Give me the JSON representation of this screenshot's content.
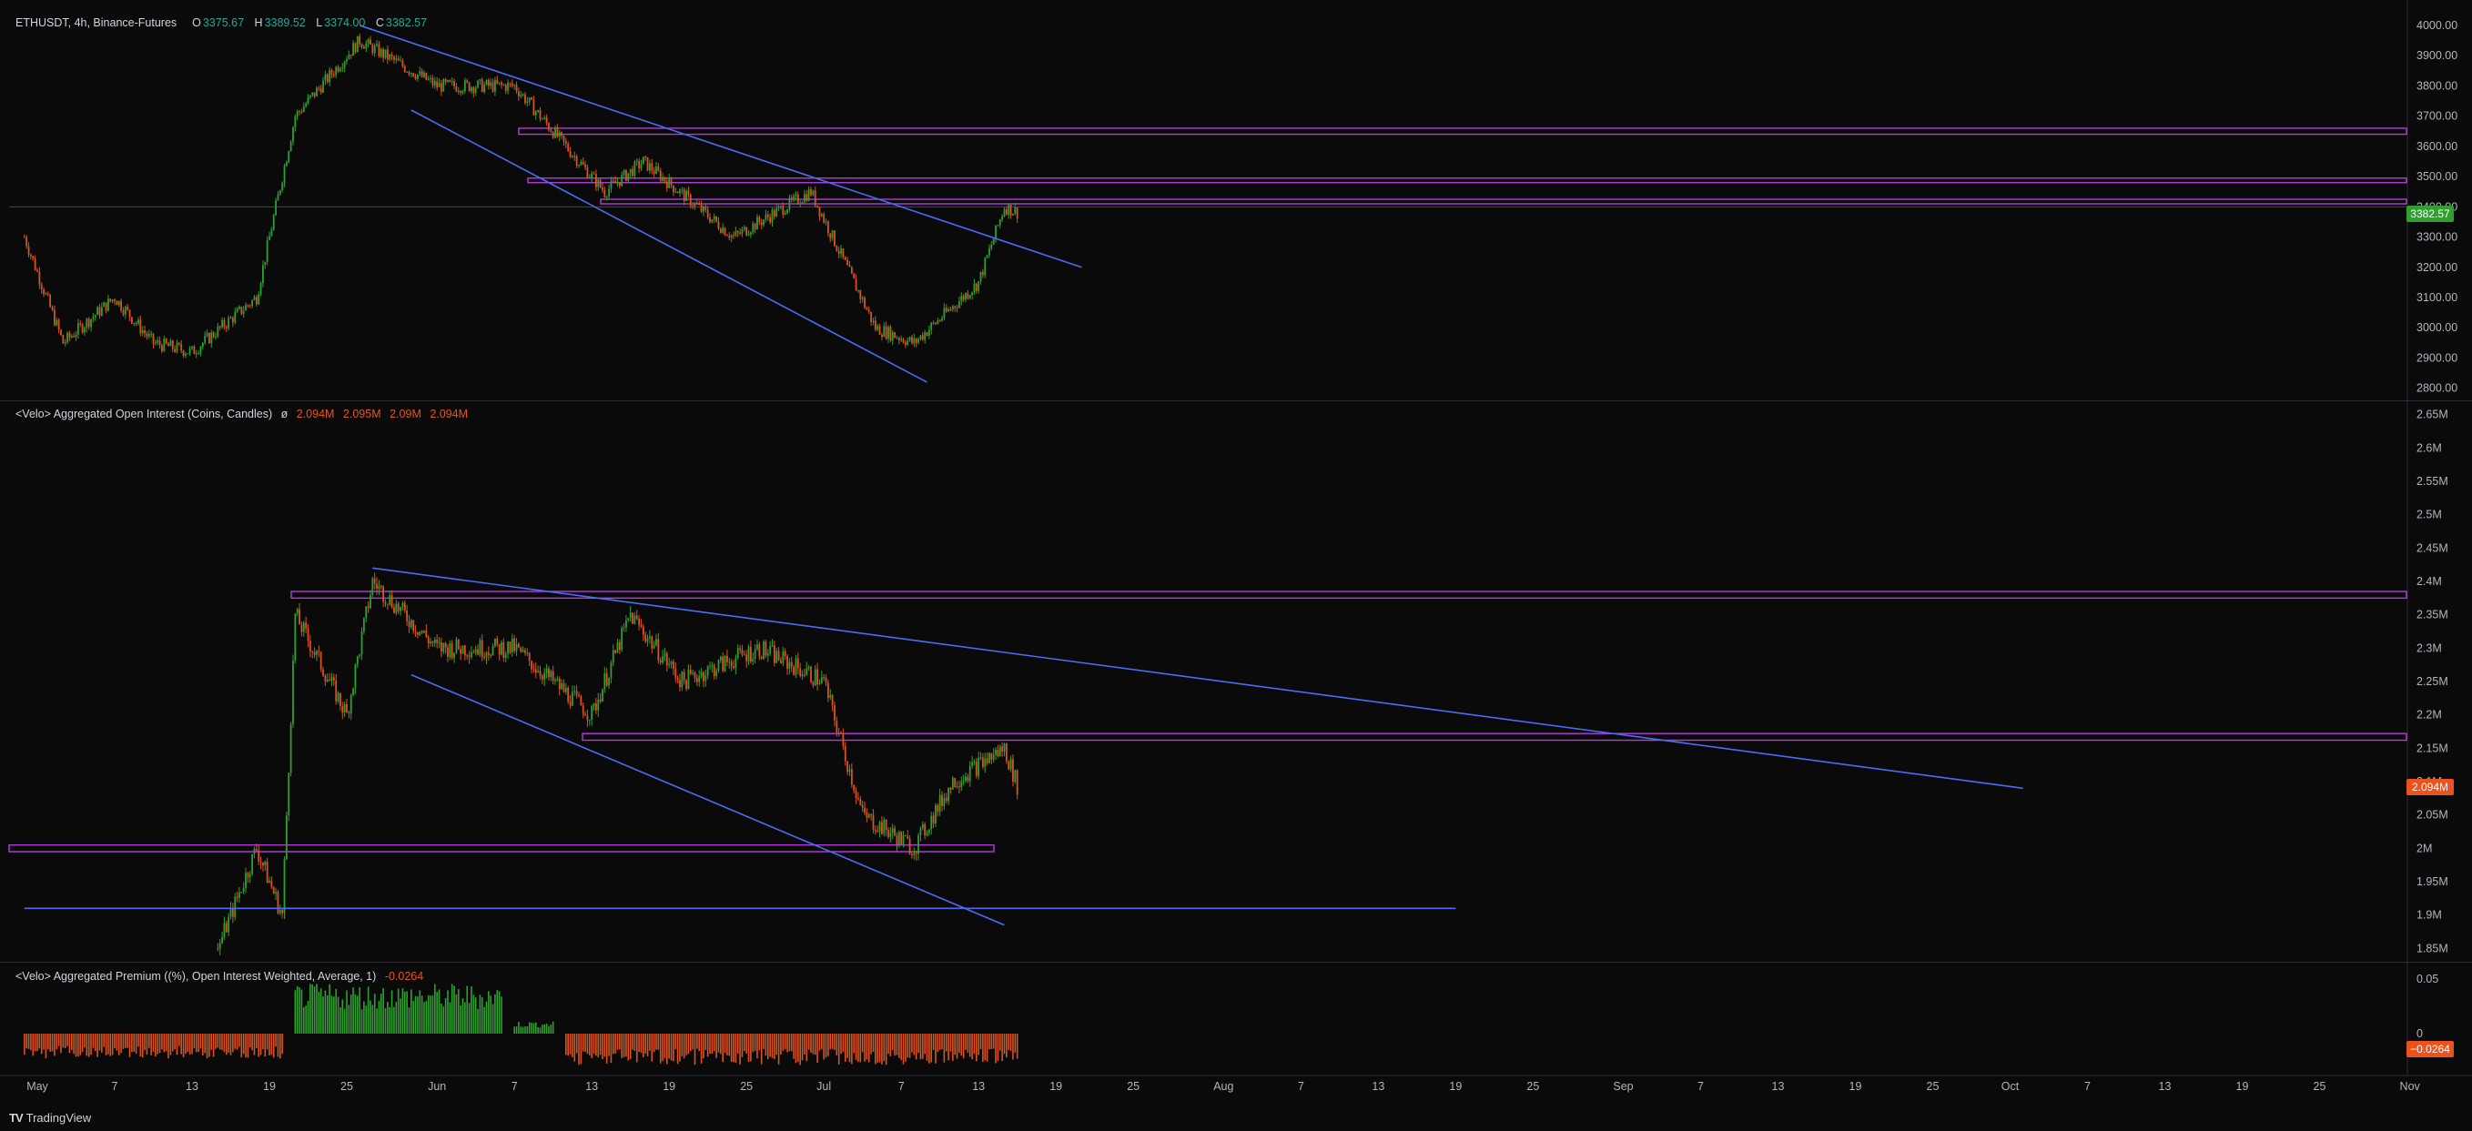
{
  "panes": {
    "price": {
      "legend_name": "ETHUSDT, 4h, Binance-Futures",
      "ohlc": [
        {
          "k": "O",
          "v": "3375.67"
        },
        {
          "k": "H",
          "v": "3389.52"
        },
        {
          "k": "L",
          "v": "3374.00"
        },
        {
          "k": "C",
          "v": "3382.57"
        }
      ],
      "last_label": "3382.57",
      "axis_ticks": [
        "4000.00",
        "3900.00",
        "3800.00",
        "3700.00",
        "3600.00",
        "3500.00",
        "3400.00",
        "3300.00",
        "3200.00",
        "3100.00",
        "3000.00",
        "2900.00",
        "2800.00"
      ]
    },
    "oi": {
      "legend_name": "<Velo> Aggregated Open Interest (Coins, Candles)",
      "legend_sym": "ø",
      "values": [
        "2.094M",
        "2.095M",
        "2.09M",
        "2.094M"
      ],
      "last_label": "2.094M",
      "axis_ticks": [
        "2.65M",
        "2.6M",
        "2.55M",
        "2.5M",
        "2.45M",
        "2.4M",
        "2.35M",
        "2.3M",
        "2.25M",
        "2.2M",
        "2.15M",
        "2.1M",
        "2.05M",
        "2M",
        "1.95M",
        "1.9M",
        "1.85M"
      ]
    },
    "premium": {
      "legend_name": "<Velo> Aggregated Premium ((%), Open Interest Weighted, Average, 1)",
      "value": "-0.0264",
      "last_label": "−0.0264",
      "axis_ticks": [
        "0.05",
        "0"
      ]
    }
  },
  "time_axis": [
    "May",
    "7",
    "13",
    "19",
    "25",
    "Jun",
    "7",
    "13",
    "19",
    "25",
    "Jul",
    "7",
    "13",
    "19",
    "25",
    "Aug",
    "7",
    "13",
    "19",
    "25",
    "Sep",
    "7",
    "13",
    "19",
    "25",
    "Oct",
    "7",
    "13",
    "19",
    "25",
    "Nov"
  ],
  "brand": "TradingView",
  "colors": {
    "up": "#26a69a",
    "up_fill": "#2ea02e",
    "down": "#d9531e",
    "trendline": "#4a6cf7",
    "zone": "#b23dd6",
    "last_price_bg": "#2ea02e",
    "last_oi_bg": "#e8531e"
  },
  "chart_data": [
    {
      "type": "candlestick",
      "title": "ETHUSDT, 4h, Binance-Futures",
      "ylim": [
        2760,
        4060
      ],
      "key_points": [
        {
          "date": "2024-04-30",
          "close": 3300
        },
        {
          "date": "2024-05-03",
          "close": 2950
        },
        {
          "date": "2024-05-07",
          "close": 3100
        },
        {
          "date": "2024-05-10",
          "close": 2950
        },
        {
          "date": "2024-05-13",
          "close": 2920
        },
        {
          "date": "2024-05-18",
          "close": 3100
        },
        {
          "date": "2024-05-20",
          "close": 3500
        },
        {
          "date": "2024-05-21",
          "close": 3700
        },
        {
          "date": "2024-05-26",
          "close": 3950
        },
        {
          "date": "2024-06-01",
          "close": 3800
        },
        {
          "date": "2024-06-07",
          "close": 3800
        },
        {
          "date": "2024-06-10",
          "close": 3650
        },
        {
          "date": "2024-06-14",
          "close": 3450
        },
        {
          "date": "2024-06-17",
          "close": 3550
        },
        {
          "date": "2024-06-24",
          "close": 3300
        },
        {
          "date": "2024-06-30",
          "close": 3450
        },
        {
          "date": "2024-07-05",
          "close": 3000
        },
        {
          "date": "2024-07-08",
          "close": 2950
        },
        {
          "date": "2024-07-13",
          "close": 3150
        },
        {
          "date": "2024-07-15",
          "close": 3400
        },
        {
          "date": "2024-07-16",
          "close": 3382.57
        }
      ],
      "horizontal_zones": [
        [
          3640,
          3660
        ],
        [
          3480,
          3495
        ],
        [
          3410,
          3425
        ]
      ],
      "trendlines": [
        {
          "from": {
            "date": "2024-05-26",
            "value": 4000
          },
          "to": {
            "date": "2024-07-21",
            "value": 3200
          }
        },
        {
          "from": {
            "date": "2024-05-30",
            "value": 3720
          },
          "to": {
            "date": "2024-07-09",
            "value": 2820
          }
        }
      ]
    },
    {
      "type": "candlestick",
      "title": "<Velo> Aggregated Open Interest (Coins, Candles)",
      "ylim": [
        1.83,
        2.67
      ],
      "key_points": [
        {
          "date": "2024-05-15",
          "close": 1.85
        },
        {
          "date": "2024-05-18",
          "close": 2.0
        },
        {
          "date": "2024-05-20",
          "close": 1.9
        },
        {
          "date": "2024-05-21",
          "close": 2.35
        },
        {
          "date": "2024-05-25",
          "close": 2.2
        },
        {
          "date": "2024-05-27",
          "close": 2.4
        },
        {
          "date": "2024-06-01",
          "close": 2.3
        },
        {
          "date": "2024-06-07",
          "close": 2.3
        },
        {
          "date": "2024-06-13",
          "close": 2.2
        },
        {
          "date": "2024-06-16",
          "close": 2.35
        },
        {
          "date": "2024-06-20",
          "close": 2.25
        },
        {
          "date": "2024-06-26",
          "close": 2.3
        },
        {
          "date": "2024-07-01",
          "close": 2.25
        },
        {
          "date": "2024-07-04",
          "close": 2.05
        },
        {
          "date": "2024-07-08",
          "close": 2.0
        },
        {
          "date": "2024-07-11",
          "close": 2.1
        },
        {
          "date": "2024-07-15",
          "close": 2.15
        },
        {
          "date": "2024-07-16",
          "close": 2.094
        }
      ],
      "horizontal_zones": [
        [
          2.375,
          2.385
        ],
        [
          2.162,
          2.172
        ],
        [
          1.995,
          2.005
        ]
      ],
      "trendlines": [
        {
          "from": {
            "date": "2024-05-27",
            "value": 2.42
          },
          "to": {
            "date": "2024-10-02",
            "value": 2.09
          }
        },
        {
          "from": {
            "date": "2024-05-30",
            "value": 2.26
          },
          "to": {
            "date": "2024-07-15",
            "value": 1.885
          }
        },
        {
          "from": {
            "date": "2024-04-30",
            "value": 1.91
          },
          "to": {
            "date": "2024-08-19",
            "value": 1.91
          }
        }
      ]
    },
    {
      "type": "bar",
      "title": "<Velo> Aggregated Premium ((%), Open Interest Weighted, Average, 1)",
      "ylim": [
        -0.035,
        0.065
      ],
      "segments": [
        {
          "from": "2024-04-30",
          "to": "2024-05-20",
          "value": -0.02
        },
        {
          "from": "2024-05-21",
          "to": "2024-06-06",
          "value": 0.04
        },
        {
          "from": "2024-06-07",
          "to": "2024-06-10",
          "value": 0.01
        },
        {
          "from": "2024-06-11",
          "to": "2024-07-16",
          "value": -0.025
        }
      ]
    }
  ]
}
